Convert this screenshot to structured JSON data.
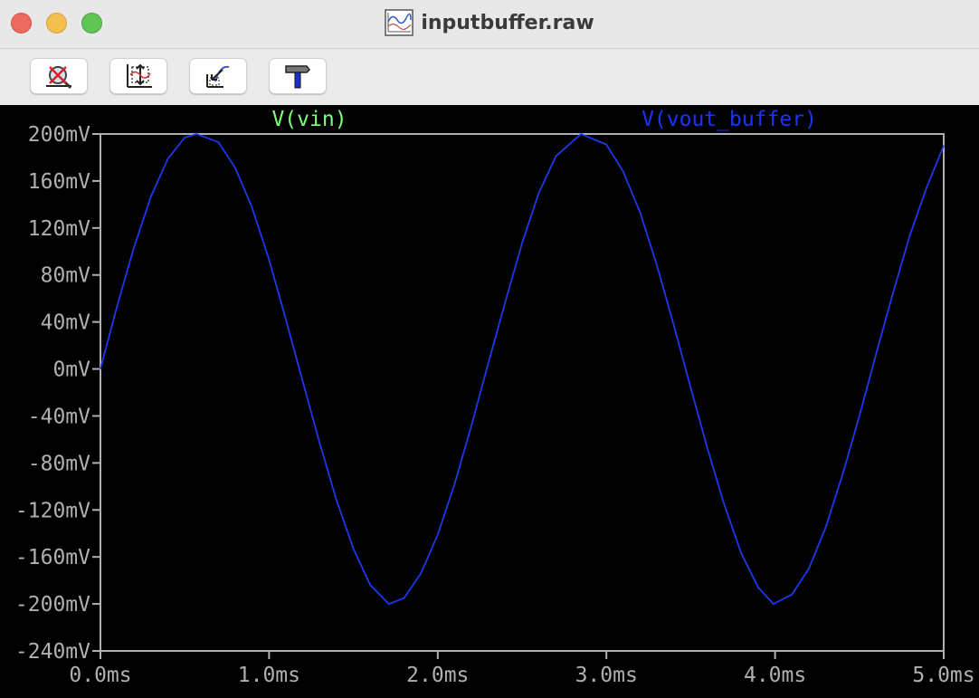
{
  "window": {
    "title": "inputbuffer.raw",
    "icon": "waveform-viewer-icon",
    "controls": [
      "close",
      "minimize",
      "maximize"
    ]
  },
  "toolbar": {
    "buttons": [
      {
        "name": "autorange-cancel-icon"
      },
      {
        "name": "zoom-extents-icon"
      },
      {
        "name": "zoom-back-icon"
      },
      {
        "name": "hammer-icon"
      }
    ]
  },
  "colors": {
    "plot_background": "#000000",
    "axis": "#b0b0b0",
    "vin": "#7dff7d",
    "vout_buffer": "#1a33ff"
  },
  "chart_data": {
    "type": "line",
    "title": "",
    "xlabel": "",
    "ylabel": "",
    "xlim": [
      0,
      5.0
    ],
    "ylim": [
      -240,
      200
    ],
    "x_ticks": [
      0,
      1,
      2,
      3,
      4,
      5
    ],
    "x_tick_labels": [
      "0.0ms",
      "1.0ms",
      "2.0ms",
      "3.0ms",
      "4.0ms",
      "5.0ms"
    ],
    "y_ticks": [
      200,
      160,
      120,
      80,
      40,
      0,
      -40,
      -80,
      -120,
      -160,
      -200,
      -240
    ],
    "y_tick_labels": [
      "200mV",
      "160mV",
      "120mV",
      "80mV",
      "40mV",
      "0mV",
      "-40mV",
      "-80mV",
      "-120mV",
      "-160mV",
      "-200mV",
      "-240mV"
    ],
    "grid": false,
    "legend": "top",
    "series": [
      {
        "name": "V(vin)",
        "color": "#7dff7d",
        "x": [
          0,
          0.1,
          0.2,
          0.3,
          0.4,
          0.5,
          0.57,
          0.7,
          0.8,
          0.9,
          1.0,
          1.1,
          1.2,
          1.3,
          1.4,
          1.5,
          1.6,
          1.71,
          1.8,
          1.9,
          2.0,
          2.1,
          2.2,
          2.3,
          2.4,
          2.5,
          2.6,
          2.7,
          2.85,
          3.0,
          3.1,
          3.2,
          3.3,
          3.4,
          3.5,
          3.6,
          3.7,
          3.8,
          3.9,
          3.99,
          4.1,
          4.2,
          4.3,
          4.4,
          4.5,
          4.6,
          4.7,
          4.8,
          4.9,
          5.0
        ],
        "y": [
          0,
          54,
          104,
          147,
          179,
          197,
          200,
          193,
          171,
          137,
          93,
          42,
          -11,
          -63,
          -112,
          -153,
          -184,
          -200,
          -195,
          -174,
          -141,
          -98,
          -48,
          5,
          57,
          107,
          150,
          181,
          200,
          191,
          168,
          133,
          88,
          37,
          -16,
          -68,
          -116,
          -157,
          -186,
          -200,
          -192,
          -170,
          -135,
          -90,
          -40,
          13,
          65,
          114,
          155,
          190
        ]
      },
      {
        "name": "V(vout_buffer)",
        "color": "#1a33ff",
        "x": [
          0,
          0.1,
          0.2,
          0.3,
          0.4,
          0.5,
          0.57,
          0.7,
          0.8,
          0.9,
          1.0,
          1.1,
          1.2,
          1.3,
          1.4,
          1.5,
          1.6,
          1.71,
          1.8,
          1.9,
          2.0,
          2.1,
          2.2,
          2.3,
          2.4,
          2.5,
          2.6,
          2.7,
          2.85,
          3.0,
          3.1,
          3.2,
          3.3,
          3.4,
          3.5,
          3.6,
          3.7,
          3.8,
          3.9,
          3.99,
          4.1,
          4.2,
          4.3,
          4.4,
          4.5,
          4.6,
          4.7,
          4.8,
          4.9,
          5.0
        ],
        "y": [
          0,
          54,
          104,
          147,
          179,
          197,
          200,
          193,
          171,
          137,
          93,
          42,
          -11,
          -63,
          -112,
          -153,
          -184,
          -200,
          -195,
          -174,
          -141,
          -98,
          -48,
          5,
          57,
          107,
          150,
          181,
          200,
          191,
          168,
          133,
          88,
          37,
          -16,
          -68,
          -116,
          -157,
          -186,
          -200,
          -192,
          -170,
          -135,
          -90,
          -40,
          13,
          65,
          114,
          155,
          190
        ]
      }
    ]
  }
}
